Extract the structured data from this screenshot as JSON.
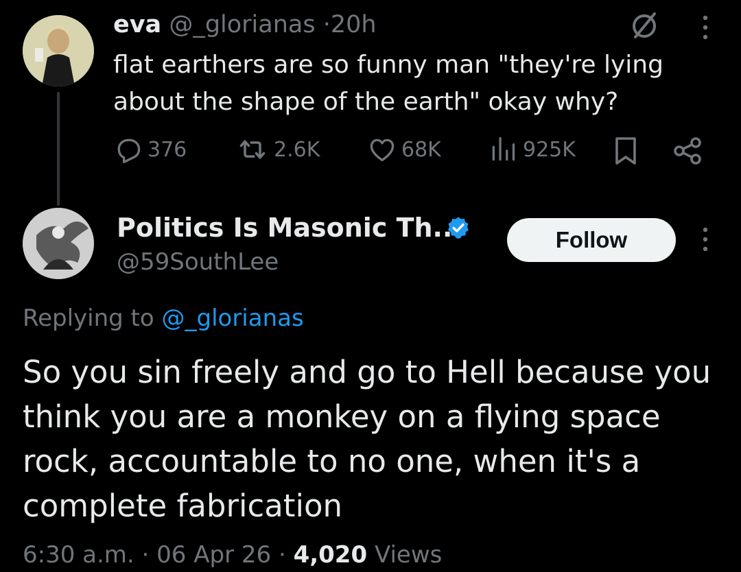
{
  "parent_tweet": {
    "display_name": "eva",
    "handle": "@_glorianas",
    "separator": "·",
    "time": "20h",
    "text": "flat earthers are so funny man \"they're lying about the shape of the earth\" okay why?",
    "replies": "376",
    "reposts": "2.6K",
    "likes": "68K",
    "views": "925K",
    "icons": [
      "grok-icon",
      "more-icon",
      "reply-icon",
      "repost-icon",
      "like-icon",
      "views-icon",
      "bookmark-icon",
      "share-icon"
    ]
  },
  "reply_tweet": {
    "display_name": "Politics Is Masonic Th...",
    "handle": "@59SouthLee",
    "verified": true,
    "follow_label": "Follow",
    "replying_prefix": "Replying to",
    "replying_handle": "@_glorianas",
    "text": "So you sin freely and go to Hell because you think you are a monkey on a flying space rock, accountable to no one, when it's a complete fabrication",
    "time": "6:30 a.m.",
    "date": "06 Apr 26",
    "separator": "·",
    "views_count": "4,020",
    "views_label": "Views"
  },
  "colors": {
    "background": "#000000",
    "text_primary": "#e7e9ea",
    "text_secondary": "#71767b",
    "accent": "#1d9bf0",
    "follow_button_bg": "#eff3f4"
  }
}
